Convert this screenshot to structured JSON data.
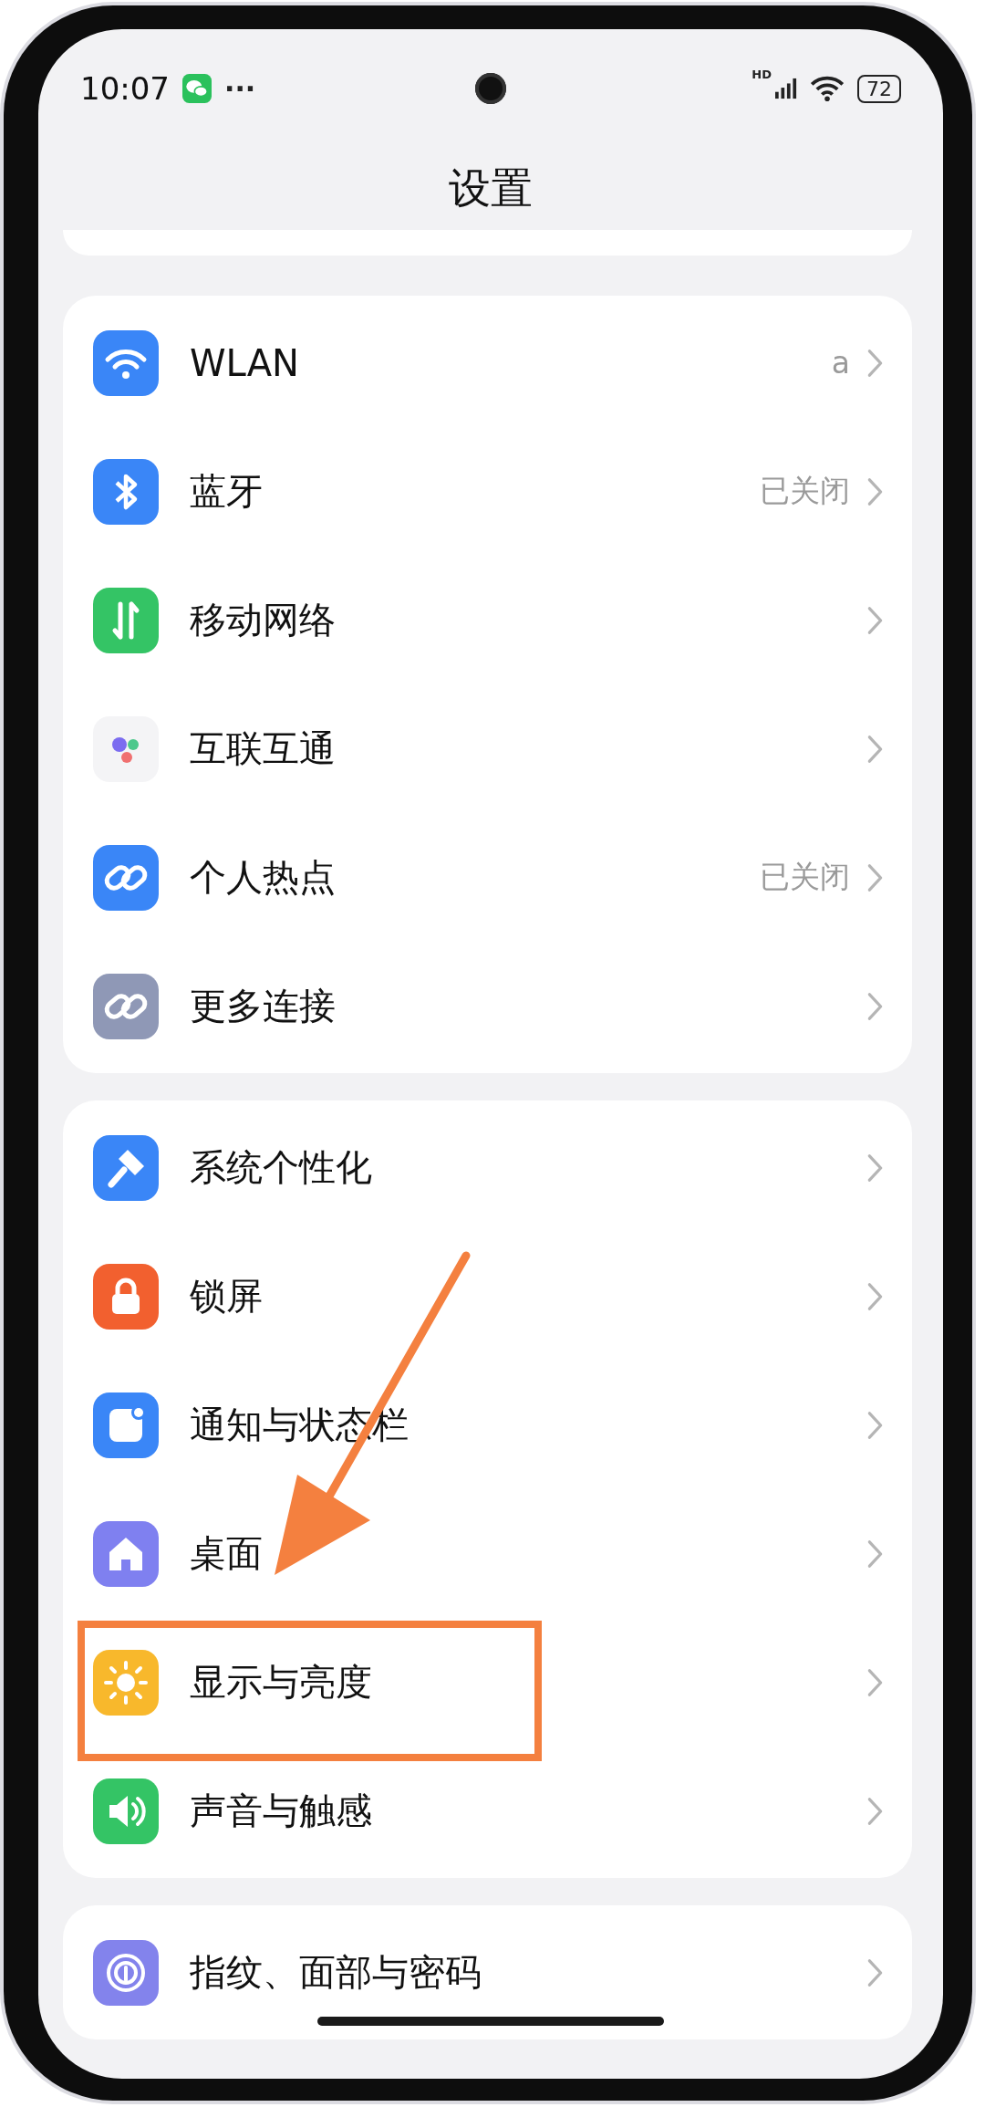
{
  "status_bar": {
    "time": "10:07",
    "more": "···",
    "network_label": "HD",
    "battery": "72"
  },
  "title": "设置",
  "groups": [
    {
      "items": [
        {
          "kind": "wifi",
          "label": "WLAN",
          "value": "a",
          "highlighted": false
        },
        {
          "kind": "bluetooth",
          "label": "蓝牙",
          "value": "已关闭",
          "highlighted": false
        },
        {
          "kind": "mobile",
          "label": "移动网络",
          "highlighted": false
        },
        {
          "kind": "interconnect",
          "label": "互联互通",
          "highlighted": false
        },
        {
          "kind": "hotspot",
          "label": "个人热点",
          "value": "已关闭",
          "highlighted": false
        },
        {
          "kind": "more",
          "label": "更多连接",
          "highlighted": false
        }
      ]
    },
    {
      "items": [
        {
          "kind": "personalize",
          "label": "系统个性化",
          "highlighted": false
        },
        {
          "kind": "lock",
          "label": "锁屏",
          "highlighted": false
        },
        {
          "kind": "notify",
          "label": "通知与状态栏",
          "highlighted": false
        },
        {
          "kind": "home",
          "label": "桌面",
          "highlighted": false
        },
        {
          "kind": "display",
          "label": "显示与亮度",
          "highlighted": true
        },
        {
          "kind": "sound",
          "label": "声音与触感",
          "highlighted": false
        }
      ]
    },
    {
      "items": [
        {
          "kind": "fingerprint",
          "label": "指纹、面部与密码",
          "highlighted": false
        }
      ]
    }
  ]
}
